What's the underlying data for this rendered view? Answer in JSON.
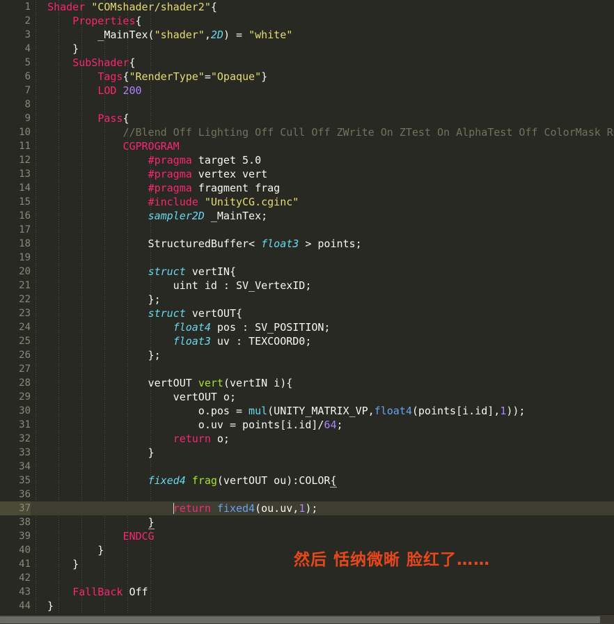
{
  "editor": {
    "background_color": "#282923",
    "active_line_number": 37,
    "line_count": 44,
    "font_size_px": 15,
    "line_height_px": 20
  },
  "colors": {
    "keyword": "#f92672",
    "string": "#e6db74",
    "type": "#66d9ef",
    "function": "#a6e22e",
    "number": "#ae81ff",
    "comment": "#75715e",
    "plain": "#f8f8f2",
    "builtin_blue": "#66a3ef",
    "gutter_text": "#8a8a78",
    "active_line_bg": "#3d3d32",
    "active_gutter_bg": "#4a4a36",
    "overlay_text": "#e8471c",
    "scrollbar_thumb": "#6b6b66",
    "indent_guide": "#4e4e44"
  },
  "overlay": {
    "text": "然后 恬纳微晰 脸红了……"
  },
  "scrollbar": {
    "orientation": "horizontal",
    "thumb_start_pct": 0,
    "thumb_width_pct": 97.7
  },
  "indent_guides_x": [
    51,
    84,
    117,
    150,
    183,
    216
  ],
  "lines": [
    {
      "n": 1,
      "tokens": [
        {
          "c": "plain",
          "t": "  "
        },
        {
          "c": "key",
          "t": "Shader"
        },
        {
          "c": "plain",
          "t": " "
        },
        {
          "c": "str",
          "t": "\"COMshader/shader2\""
        },
        {
          "c": "plain",
          "t": "{"
        }
      ]
    },
    {
      "n": 2,
      "tokens": [
        {
          "c": "plain",
          "t": "      "
        },
        {
          "c": "key",
          "t": "Properties"
        },
        {
          "c": "plain",
          "t": "{"
        }
      ]
    },
    {
      "n": 3,
      "tokens": [
        {
          "c": "plain",
          "t": "          _MainTex("
        },
        {
          "c": "str",
          "t": "\"shader\""
        },
        {
          "c": "plain",
          "t": ","
        },
        {
          "c": "type",
          "t": "2D"
        },
        {
          "c": "plain",
          "t": ") = "
        },
        {
          "c": "str",
          "t": "\"white\""
        }
      ]
    },
    {
      "n": 4,
      "tokens": [
        {
          "c": "plain",
          "t": "      }"
        }
      ]
    },
    {
      "n": 5,
      "tokens": [
        {
          "c": "plain",
          "t": "      "
        },
        {
          "c": "key",
          "t": "SubShader"
        },
        {
          "c": "plain",
          "t": "{"
        }
      ]
    },
    {
      "n": 6,
      "tokens": [
        {
          "c": "plain",
          "t": "          "
        },
        {
          "c": "key",
          "t": "Tags"
        },
        {
          "c": "plain",
          "t": "{"
        },
        {
          "c": "str",
          "t": "\"RenderType\""
        },
        {
          "c": "plain",
          "t": "="
        },
        {
          "c": "str",
          "t": "\"Opaque\""
        },
        {
          "c": "plain",
          "t": "}"
        }
      ]
    },
    {
      "n": 7,
      "tokens": [
        {
          "c": "plain",
          "t": "          "
        },
        {
          "c": "key",
          "t": "LOD"
        },
        {
          "c": "plain",
          "t": " "
        },
        {
          "c": "num",
          "t": "200"
        }
      ]
    },
    {
      "n": 8,
      "tokens": [
        {
          "c": "plain",
          "t": ""
        }
      ]
    },
    {
      "n": 9,
      "tokens": [
        {
          "c": "plain",
          "t": "          "
        },
        {
          "c": "key",
          "t": "Pass"
        },
        {
          "c": "plain",
          "t": "{"
        }
      ]
    },
    {
      "n": 10,
      "tokens": [
        {
          "c": "plain",
          "t": "              "
        },
        {
          "c": "com",
          "t": "//Blend Off Lighting Off Cull Off ZWrite On ZTest On AlphaTest Off ColorMask RGB"
        }
      ]
    },
    {
      "n": 11,
      "tokens": [
        {
          "c": "plain",
          "t": "              "
        },
        {
          "c": "key",
          "t": "CGPROGRAM"
        }
      ]
    },
    {
      "n": 12,
      "tokens": [
        {
          "c": "plain",
          "t": "                  "
        },
        {
          "c": "key",
          "t": "#pragma"
        },
        {
          "c": "plain",
          "t": " target 5.0"
        }
      ]
    },
    {
      "n": 13,
      "tokens": [
        {
          "c": "plain",
          "t": "                  "
        },
        {
          "c": "key",
          "t": "#pragma"
        },
        {
          "c": "plain",
          "t": " vertex vert"
        }
      ]
    },
    {
      "n": 14,
      "tokens": [
        {
          "c": "plain",
          "t": "                  "
        },
        {
          "c": "key",
          "t": "#pragma"
        },
        {
          "c": "plain",
          "t": " fragment frag"
        }
      ]
    },
    {
      "n": 15,
      "tokens": [
        {
          "c": "plain",
          "t": "                  "
        },
        {
          "c": "key",
          "t": "#include"
        },
        {
          "c": "plain",
          "t": " "
        },
        {
          "c": "str",
          "t": "\"UnityCG.cginc\""
        }
      ]
    },
    {
      "n": 16,
      "tokens": [
        {
          "c": "plain",
          "t": "                  "
        },
        {
          "c": "type",
          "t": "sampler2D"
        },
        {
          "c": "plain",
          "t": " _MainTex;"
        }
      ]
    },
    {
      "n": 17,
      "tokens": [
        {
          "c": "plain",
          "t": ""
        }
      ]
    },
    {
      "n": 18,
      "tokens": [
        {
          "c": "plain",
          "t": "                  StructuredBuffer< "
        },
        {
          "c": "type",
          "t": "float3"
        },
        {
          "c": "plain",
          "t": " > points;"
        }
      ]
    },
    {
      "n": 19,
      "tokens": [
        {
          "c": "plain",
          "t": ""
        }
      ]
    },
    {
      "n": 20,
      "tokens": [
        {
          "c": "plain",
          "t": "                  "
        },
        {
          "c": "type",
          "t": "struct"
        },
        {
          "c": "plain",
          "t": " vertIN{"
        }
      ]
    },
    {
      "n": 21,
      "tokens": [
        {
          "c": "plain",
          "t": "                      uint id : SV_VertexID;"
        }
      ]
    },
    {
      "n": 22,
      "tokens": [
        {
          "c": "plain",
          "t": "                  };"
        }
      ]
    },
    {
      "n": 23,
      "tokens": [
        {
          "c": "plain",
          "t": "                  "
        },
        {
          "c": "type",
          "t": "struct"
        },
        {
          "c": "plain",
          "t": " vertOUT{"
        }
      ]
    },
    {
      "n": 24,
      "tokens": [
        {
          "c": "plain",
          "t": "                      "
        },
        {
          "c": "type",
          "t": "float4"
        },
        {
          "c": "plain",
          "t": " pos : SV_POSITION;"
        }
      ]
    },
    {
      "n": 25,
      "tokens": [
        {
          "c": "plain",
          "t": "                      "
        },
        {
          "c": "type",
          "t": "float3"
        },
        {
          "c": "plain",
          "t": " uv : TEXCOORD0;"
        }
      ]
    },
    {
      "n": 26,
      "tokens": [
        {
          "c": "plain",
          "t": "                  };"
        }
      ]
    },
    {
      "n": 27,
      "tokens": [
        {
          "c": "plain",
          "t": ""
        }
      ]
    },
    {
      "n": 28,
      "tokens": [
        {
          "c": "plain",
          "t": "                  vertOUT "
        },
        {
          "c": "func",
          "t": "vert"
        },
        {
          "c": "plain",
          "t": "(vertIN i){"
        }
      ]
    },
    {
      "n": 29,
      "tokens": [
        {
          "c": "plain",
          "t": "                      vertOUT o;"
        }
      ]
    },
    {
      "n": 30,
      "tokens": [
        {
          "c": "plain",
          "t": "                          o.pos = "
        },
        {
          "c": "typep",
          "t": "mul"
        },
        {
          "c": "plain",
          "t": "(UNITY_MATRIX_VP,"
        },
        {
          "c": "blue",
          "t": "float4"
        },
        {
          "c": "plain",
          "t": "(points[i.id],"
        },
        {
          "c": "num",
          "t": "1"
        },
        {
          "c": "plain",
          "t": "));"
        }
      ]
    },
    {
      "n": 31,
      "tokens": [
        {
          "c": "plain",
          "t": "                          o.uv = points[i.id]/"
        },
        {
          "c": "num",
          "t": "64"
        },
        {
          "c": "plain",
          "t": ";"
        }
      ]
    },
    {
      "n": 32,
      "tokens": [
        {
          "c": "plain",
          "t": "                      "
        },
        {
          "c": "key",
          "t": "return"
        },
        {
          "c": "plain",
          "t": " o;"
        }
      ]
    },
    {
      "n": 33,
      "tokens": [
        {
          "c": "plain",
          "t": "                  }"
        }
      ]
    },
    {
      "n": 34,
      "tokens": [
        {
          "c": "plain",
          "t": ""
        }
      ]
    },
    {
      "n": 35,
      "tokens": [
        {
          "c": "plain",
          "t": "                  "
        },
        {
          "c": "type",
          "t": "fixed4"
        },
        {
          "c": "plain",
          "t": " "
        },
        {
          "c": "func",
          "t": "frag"
        },
        {
          "c": "plain",
          "t": "(vertOUT ou):COLOR"
        },
        {
          "c": "brace",
          "t": "{"
        }
      ]
    },
    {
      "n": 36,
      "tokens": [
        {
          "c": "plain",
          "t": ""
        }
      ]
    },
    {
      "n": 37,
      "tokens": [
        {
          "c": "plain",
          "t": "                      "
        },
        {
          "c": "caret",
          "t": ""
        },
        {
          "c": "key",
          "t": "return"
        },
        {
          "c": "plain",
          "t": " "
        },
        {
          "c": "blue",
          "t": "fixed4"
        },
        {
          "c": "plain",
          "t": "(ou.uv,"
        },
        {
          "c": "num",
          "t": "1"
        },
        {
          "c": "plain",
          "t": ");"
        }
      ]
    },
    {
      "n": 38,
      "tokens": [
        {
          "c": "plain",
          "t": "                  "
        },
        {
          "c": "brace",
          "t": "}"
        }
      ]
    },
    {
      "n": 39,
      "tokens": [
        {
          "c": "plain",
          "t": "              "
        },
        {
          "c": "key",
          "t": "ENDCG"
        }
      ]
    },
    {
      "n": 40,
      "tokens": [
        {
          "c": "plain",
          "t": "          }"
        }
      ]
    },
    {
      "n": 41,
      "tokens": [
        {
          "c": "plain",
          "t": "      }"
        }
      ]
    },
    {
      "n": 42,
      "tokens": [
        {
          "c": "plain",
          "t": ""
        }
      ]
    },
    {
      "n": 43,
      "tokens": [
        {
          "c": "plain",
          "t": "      "
        },
        {
          "c": "key",
          "t": "FallBack"
        },
        {
          "c": "plain",
          "t": " Off"
        }
      ]
    },
    {
      "n": 44,
      "tokens": [
        {
          "c": "plain",
          "t": "  }"
        }
      ]
    }
  ]
}
